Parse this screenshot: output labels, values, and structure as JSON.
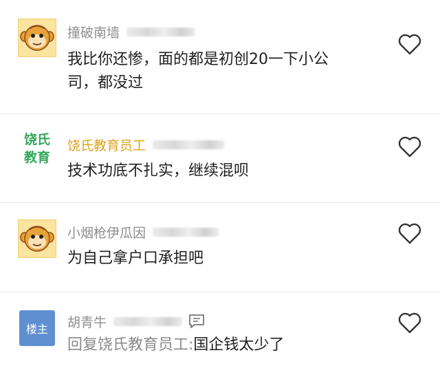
{
  "comments": [
    {
      "author": "撞破南墙",
      "avatar_icon": "monkey-avatar",
      "text_line1": "我比你还惨，面的都是初创20一下小公",
      "text_line2": "司，都没过",
      "liked": false
    },
    {
      "author": "饶氏教育员工",
      "avatar_text_line1": "饶氏",
      "avatar_text_line2": "教育",
      "author_color": "#e0a21b",
      "text_line1": "技术功底不扎实，继续混呗",
      "liked": false
    },
    {
      "author": "小烟枪伊瓜因",
      "avatar_icon": "monkey-avatar",
      "text_line1": "为自己拿户口承担吧",
      "liked": false
    },
    {
      "author": "胡青牛",
      "avatar_text": "楼主",
      "reply_prefix": "回复饶氏教育员工:",
      "text_body": "国企钱太少了",
      "liked": false
    }
  ]
}
